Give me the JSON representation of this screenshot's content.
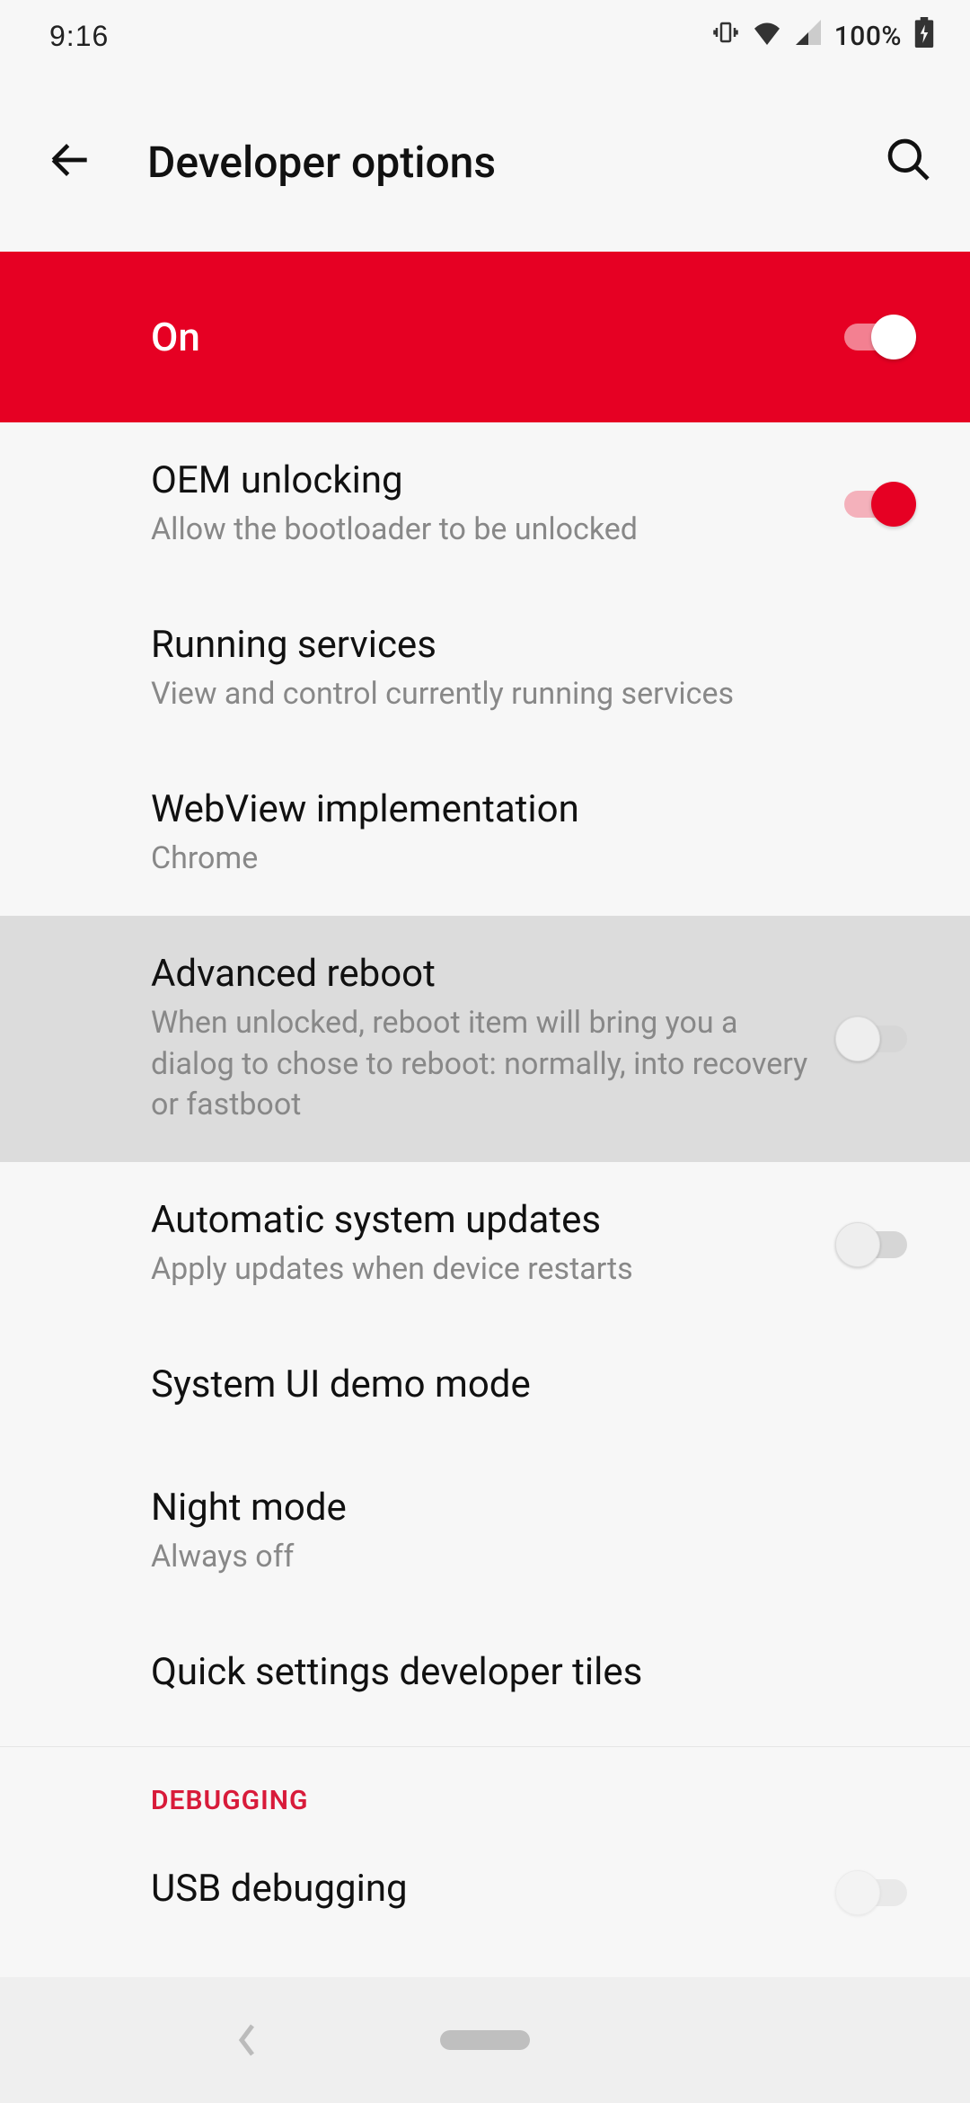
{
  "status": {
    "time": "9:16",
    "battery_pct": "100%"
  },
  "header": {
    "title": "Developer options"
  },
  "banner": {
    "label": "On",
    "state": "on"
  },
  "rows": {
    "oem": {
      "title": "OEM unlocking",
      "sub": "Allow the bootloader to be unlocked",
      "switch": "on"
    },
    "running": {
      "title": "Running services",
      "sub": "View and control currently running services"
    },
    "webview": {
      "title": "WebView implementation",
      "sub": "Chrome"
    },
    "advanced_reboot": {
      "title": "Advanced reboot",
      "sub": "When unlocked, reboot item will bring you a dialog to chose to reboot: normally, into recovery or fastboot",
      "switch": "off"
    },
    "auto_update": {
      "title": "Automatic system updates",
      "sub": "Apply updates when device restarts",
      "switch": "off"
    },
    "demo_mode": {
      "title": "System UI demo mode"
    },
    "night_mode": {
      "title": "Night mode",
      "sub": "Always off"
    },
    "quick_tiles": {
      "title": "Quick settings developer tiles"
    },
    "usb_debug": {
      "title": "USB debugging"
    }
  },
  "section": {
    "debugging": "DEBUGGING"
  }
}
